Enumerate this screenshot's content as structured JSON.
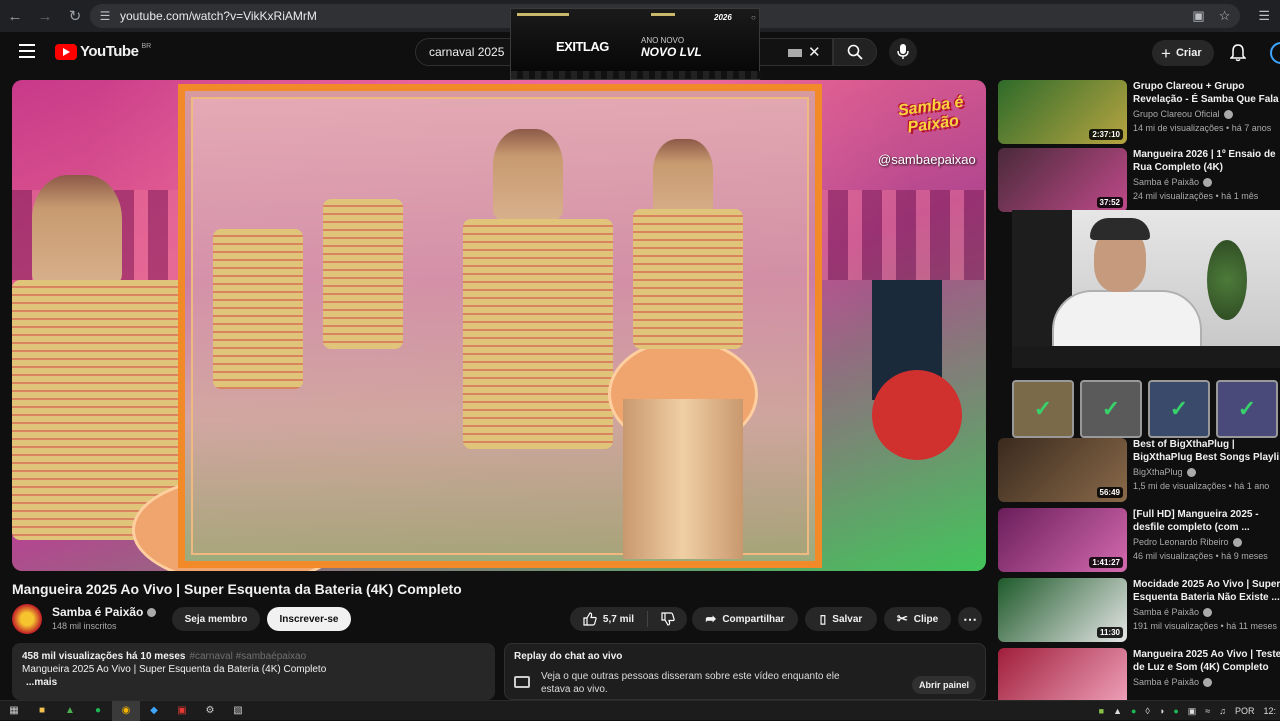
{
  "browser": {
    "url": "youtube.com/watch?v=VikKxRiAMrM",
    "icons": [
      "back-arrow-icon",
      "forward-arrow-icon",
      "reload-icon",
      "site-settings-icon",
      "install-app-icon",
      "bookmark-star-icon",
      "side-panel-icon"
    ]
  },
  "header": {
    "logo_text": "YouTube",
    "logo_country": "BR",
    "search_value": "carnaval 2025",
    "create_label": "Criar"
  },
  "ad": {
    "brand": "EXITLAG",
    "line1": "ANO NOVO",
    "line2": "NOVO LVL",
    "corner": "2026"
  },
  "video": {
    "overlay_logo": "Samba é Paixão",
    "overlay_handle": "@sambaepaixao",
    "title": "Mangueira 2025 Ao Vivo | Super Esquenta da Bateria (4K) Completo",
    "channel": "Samba é Paixão",
    "subscribers": "148 mil inscritos",
    "member_label": "Seja membro",
    "subscribe_label": "Inscrever-se",
    "likes": "5,7 mil",
    "share_label": "Compartilhar",
    "save_label": "Salvar",
    "clip_label": "Clipe"
  },
  "description": {
    "stats": "458 mil visualizações  há 10 meses",
    "tags": "#carnaval #sambaépaixao",
    "text": "Mangueira 2025 Ao Vivo |  Super Esquenta da Bateria (4K) Completo",
    "more": "...mais"
  },
  "chat_replay": {
    "title": "Replay do chat ao vivo",
    "body": "Veja o que outras pessoas disseram sobre este vídeo enquanto ele estava ao vivo.",
    "button": "Abrir painel"
  },
  "recommendations": [
    {
      "title": "Grupo Clareou + Grupo\nRevelação - É Samba Que Fala",
      "channel": "Grupo Clareou Oficial",
      "meta": "14 mi de visualizações • há 7 anos",
      "duration": "2:37:10",
      "color1": "#2e6b2a",
      "color2": "#b7a541"
    },
    {
      "title": "Mangueira 2026 | 1º Ensaio de\nRua Completo (4K)",
      "channel": "Samba é Paixão",
      "meta": "24 mil visualizações • há 1 mês",
      "duration": "37:52",
      "color1": "#4a2a3a",
      "color2": "#c04a8a"
    },
    {
      "title": "Best of BigXthaPlug |\nBigXthaPlug Best Songs Playli",
      "channel": "BigXthaPlug",
      "meta": "1,5 mi de visualizações • há 1 ano",
      "duration": "56:49",
      "color1": "#3a2a1e",
      "color2": "#8a6a4a"
    },
    {
      "title": "[Full HD] Mangueira 2025 -\ndesfile completo (com ...",
      "channel": "Pedro Leonardo Ribeiro",
      "meta": "46 mil visualizações • há 9 meses",
      "duration": "1:41:27",
      "color1": "#6a1e5a",
      "color2": "#d46ab0"
    },
    {
      "title": "Mocidade 2025 Ao Vivo | Super\nEsquenta Bateria Não Existe ...",
      "channel": "Samba é Paixão",
      "meta": "191 mil visualizações • há 11 meses",
      "duration": "11:30",
      "color1": "#1e5a2a",
      "color2": "#e6e6e6"
    },
    {
      "title": "Mangueira 2025 Ao Vivo | Teste\nde Luz e Som (4K) Completo",
      "channel": "Samba é Paixão",
      "meta": "",
      "duration": "",
      "color1": "#a01e3a",
      "color2": "#f2a6c0"
    }
  ],
  "taskbar": {
    "language": "POR",
    "time": "12:"
  }
}
